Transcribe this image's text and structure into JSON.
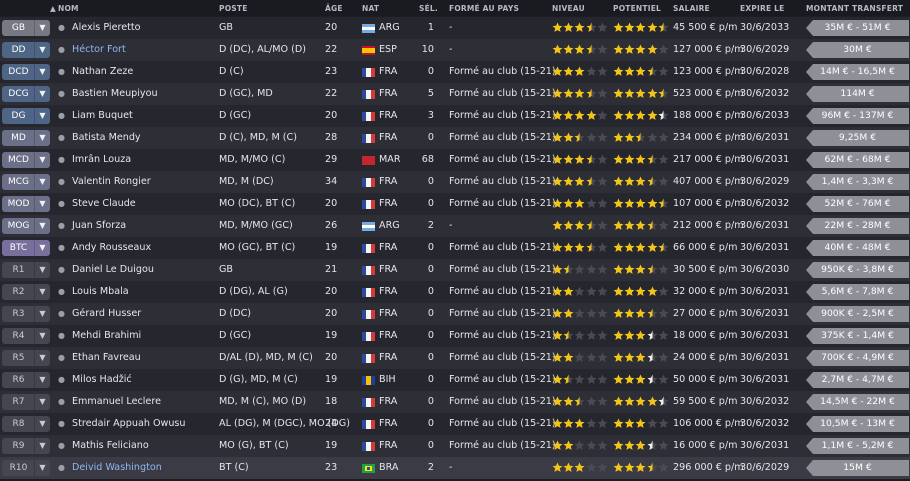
{
  "columns": {
    "nom": "NOM",
    "poste": "POSTE",
    "age": "ÂGE",
    "nat": "NAT",
    "sel": "SÉL.",
    "forme": "FORMÉ AU PAYS",
    "niveau": "NIVEAU",
    "potentiel": "POTENTIEL",
    "salaire": "SALAIRE",
    "expire": "EXPIRE LE",
    "montant": "MONTANT TRANSFERT"
  },
  "colors": {
    "star_gold": "#f0c419",
    "star_empty": "#4a4b52",
    "star_white": "#f2f2f2",
    "link_name": "#8fb6f0"
  },
  "players": [
    {
      "pos": "GB",
      "pos_group": "gk",
      "status_icon": "person-icon",
      "name": "Alexis Pieretto",
      "poste": "GB",
      "age": "20",
      "nat": "ARG",
      "sel": "1",
      "forme": "-",
      "niveau": [
        3.5,
        0
      ],
      "potentiel": [
        4.5,
        0
      ],
      "salaire": "45 500 € p/m",
      "expire": "30/6/2033",
      "montant": "35M € - 51M €"
    },
    {
      "pos": "DD",
      "pos_group": "def",
      "status_icon": "person-icon",
      "name": "Héctor Fort",
      "name_link": true,
      "poste": "D (DC), AL/MO (D)",
      "age": "22",
      "nat": "ESP",
      "sel": "10",
      "forme": "-",
      "niveau": [
        3.5,
        0
      ],
      "potentiel": [
        4,
        0
      ],
      "salaire": "127 000 € p/m",
      "expire": "30/6/2029",
      "montant": "30M €"
    },
    {
      "pos": "DCD",
      "pos_group": "def",
      "status_icon": "person-icon",
      "name": "Nathan Zeze",
      "poste": "D (C)",
      "age": "23",
      "nat": "FRA",
      "sel": "0",
      "forme": "Formé au club (15-21)",
      "niveau": [
        3,
        0
      ],
      "potentiel": [
        3.5,
        0
      ],
      "salaire": "123 000 € p/m",
      "expire": "30/6/2028",
      "montant": "14M € - 16,5M €"
    },
    {
      "pos": "DCG",
      "pos_group": "def",
      "status_icon": "person-icon",
      "name": "Bastien Meupiyou",
      "poste": "D (GC), MD",
      "age": "22",
      "nat": "FRA",
      "sel": "5",
      "forme": "Formé au club (15-21)",
      "niveau": [
        3.5,
        0
      ],
      "potentiel": [
        4.5,
        0
      ],
      "salaire": "523 000 € p/m",
      "expire": "30/6/2032",
      "montant": "114M €"
    },
    {
      "pos": "DG",
      "pos_group": "def",
      "status_icon": "person-icon",
      "name": "Liam Buquet",
      "poste": "D (GC)",
      "age": "20",
      "nat": "FRA",
      "sel": "3",
      "forme": "Formé au club (15-21)",
      "niveau": [
        4,
        0
      ],
      "potentiel": [
        4,
        1
      ],
      "salaire": "188 000 € p/m",
      "expire": "30/6/2033",
      "montant": "96M € - 137M €"
    },
    {
      "pos": "MD",
      "pos_group": "mid",
      "status_icon": "person-icon",
      "name": "Batista Mendy",
      "poste": "D (C), MD, M (C)",
      "age": "28",
      "nat": "FRA",
      "sel": "0",
      "forme": "Formé au club (15-21)",
      "niveau": [
        2.5,
        0
      ],
      "potentiel": [
        2.5,
        0
      ],
      "salaire": "234 000 € p/m",
      "expire": "30/6/2031",
      "montant": "9,25M €"
    },
    {
      "pos": "MCD",
      "pos_group": "mid",
      "status_icon": "person-icon",
      "name": "Imrân Louza",
      "poste": "MD, M/MO (C)",
      "age": "29",
      "nat": "MAR",
      "sel": "68",
      "forme": "Formé au club (15-21)",
      "niveau": [
        3.5,
        0
      ],
      "potentiel": [
        3.5,
        0
      ],
      "salaire": "217 000 € p/m",
      "expire": "30/6/2031",
      "montant": "62M € - 68M €"
    },
    {
      "pos": "MCG",
      "pos_group": "mid",
      "status_icon": "person-icon",
      "name": "Valentin Rongier",
      "poste": "MD, M (DC)",
      "age": "34",
      "nat": "FRA",
      "sel": "0",
      "forme": "Formé au club (15-21)",
      "niveau": [
        3.5,
        0
      ],
      "potentiel": [
        3.5,
        0
      ],
      "salaire": "407 000 € p/m",
      "expire": "30/6/2029",
      "montant": "1,4M € - 3,3M €"
    },
    {
      "pos": "MOD",
      "pos_group": "mid",
      "status_icon": "person-icon",
      "name": "Steve Claude",
      "poste": "MO (DC), BT (C)",
      "age": "20",
      "nat": "FRA",
      "sel": "0",
      "forme": "Formé au club (15-21)",
      "niveau": [
        3,
        0
      ],
      "potentiel": [
        4.5,
        0
      ],
      "salaire": "107 000 € p/m",
      "expire": "30/6/2032",
      "montant": "52M € - 76M €"
    },
    {
      "pos": "MOG",
      "pos_group": "mid",
      "status_icon": "person-icon",
      "name": "Juan Sforza",
      "poste": "MD, M/MO (GC)",
      "age": "26",
      "nat": "ARG",
      "sel": "2",
      "forme": "-",
      "niveau": [
        3.5,
        0
      ],
      "potentiel": [
        3.5,
        0
      ],
      "salaire": "212 000 € p/m",
      "expire": "30/6/2031",
      "montant": "22M € - 28M €"
    },
    {
      "pos": "BTC",
      "pos_group": "att",
      "status_icon": "person-icon",
      "name": "Andy Rousseaux",
      "poste": "MO (GC), BT (C)",
      "age": "19",
      "nat": "FRA",
      "sel": "0",
      "forme": "Formé au club (15-21)",
      "niveau": [
        3.5,
        0
      ],
      "potentiel": [
        4.5,
        0
      ],
      "salaire": "66 000 € p/m",
      "expire": "30/6/2031",
      "montant": "40M € - 48M €"
    },
    {
      "pos": "R1",
      "pos_group": "res",
      "status_icon": "person-icon",
      "name": "Daniel Le Duigou",
      "poste": "GB",
      "age": "21",
      "nat": "FRA",
      "sel": "0",
      "forme": "Formé au club (15-21)",
      "niveau": [
        1.5,
        0
      ],
      "potentiel": [
        3.5,
        0
      ],
      "salaire": "30 500 € p/m",
      "expire": "30/6/2030",
      "montant": "950K € - 3,8M €"
    },
    {
      "pos": "R2",
      "pos_group": "res",
      "status_icon": "person-icon",
      "name": "Louis Mbala",
      "poste": "D (DG), AL (G)",
      "age": "20",
      "nat": "FRA",
      "sel": "0",
      "forme": "Formé au club (15-21)",
      "niveau": [
        2,
        0
      ],
      "potentiel": [
        4,
        0
      ],
      "salaire": "32 000 € p/m",
      "expire": "30/6/2031",
      "montant": "5,6M € - 7,8M €"
    },
    {
      "pos": "R3",
      "pos_group": "res",
      "status_icon": "person-icon",
      "name": "Gérard Husser",
      "poste": "D (DC)",
      "age": "20",
      "nat": "FRA",
      "sel": "0",
      "forme": "Formé au club (15-21)",
      "niveau": [
        2,
        0
      ],
      "potentiel": [
        3.5,
        0
      ],
      "salaire": "27 000 € p/m",
      "expire": "30/6/2031",
      "montant": "900K € - 2,5M €"
    },
    {
      "pos": "R4",
      "pos_group": "res",
      "status_icon": "person-icon",
      "name": "Mehdi Brahimi",
      "poste": "D (GC)",
      "age": "19",
      "nat": "FRA",
      "sel": "0",
      "forme": "Formé au club (15-21)",
      "niveau": [
        1.5,
        0
      ],
      "potentiel": [
        3,
        1
      ],
      "salaire": "18 000 € p/m",
      "expire": "30/6/2031",
      "montant": "375K € - 1,4M €"
    },
    {
      "pos": "R5",
      "pos_group": "res",
      "status_icon": "person-icon",
      "name": "Ethan Favreau",
      "poste": "D/AL (D), MD, M (C)",
      "age": "20",
      "nat": "FRA",
      "sel": "0",
      "forme": "Formé au club (15-21)",
      "niveau": [
        2,
        0
      ],
      "potentiel": [
        3,
        1
      ],
      "salaire": "24 000 € p/m",
      "expire": "30/6/2031",
      "montant": "700K € - 4,9M €"
    },
    {
      "pos": "R6",
      "pos_group": "res",
      "status_icon": "person-icon",
      "name": "Milos Hadžić",
      "poste": "D (G), MD, M (C)",
      "age": "19",
      "nat": "BIH",
      "sel": "0",
      "forme": "Formé au club (15-21)",
      "niveau": [
        1.5,
        0
      ],
      "potentiel": [
        3,
        1
      ],
      "salaire": "50 000 € p/m",
      "expire": "30/6/2031",
      "montant": "2,7M € - 4,7M €"
    },
    {
      "pos": "R7",
      "pos_group": "res",
      "status_icon": "person-icon",
      "name": "Emmanuel Leclere",
      "poste": "MD, M (C), MO (D)",
      "age": "18",
      "nat": "FRA",
      "sel": "0",
      "forme": "Formé au club (15-21)",
      "niveau": [
        2.5,
        0
      ],
      "potentiel": [
        4,
        1
      ],
      "salaire": "59 500 € p/m",
      "expire": "30/6/2032",
      "montant": "14,5M € - 22M €"
    },
    {
      "pos": "R8",
      "pos_group": "res",
      "status_icon": "person-icon",
      "name": "Stredair Appuah Owusu",
      "poste": "AL (DG), M (DGC), MO (DG)",
      "age": "24",
      "nat": "FRA",
      "sel": "0",
      "forme": "Formé au club (15-21)",
      "niveau": [
        3,
        0
      ],
      "potentiel": [
        3,
        0
      ],
      "salaire": "106 000 € p/m",
      "expire": "30/6/2032",
      "montant": "10,5M € - 13M €"
    },
    {
      "pos": "R9",
      "pos_group": "res",
      "status_icon": "person-icon",
      "name": "Mathis Feliciano",
      "poste": "MO (G), BT (C)",
      "age": "19",
      "nat": "FRA",
      "sel": "0",
      "forme": "Formé au club (15-21)",
      "niveau": [
        2,
        0
      ],
      "potentiel": [
        3,
        1
      ],
      "salaire": "16 000 € p/m",
      "expire": "30/6/2031",
      "montant": "1,1M € - 5,2M €"
    },
    {
      "pos": "R10",
      "pos_group": "res",
      "status_icon": "person-icon",
      "name": "Deivid Washington",
      "name_link": true,
      "poste": "BT (C)",
      "age": "23",
      "nat": "BRA",
      "sel": "2",
      "forme": "-",
      "niveau": [
        3,
        0
      ],
      "potentiel": [
        3.5,
        0
      ],
      "salaire": "296 000 € p/m",
      "expire": "30/6/2029",
      "montant": "15M €"
    }
  ]
}
